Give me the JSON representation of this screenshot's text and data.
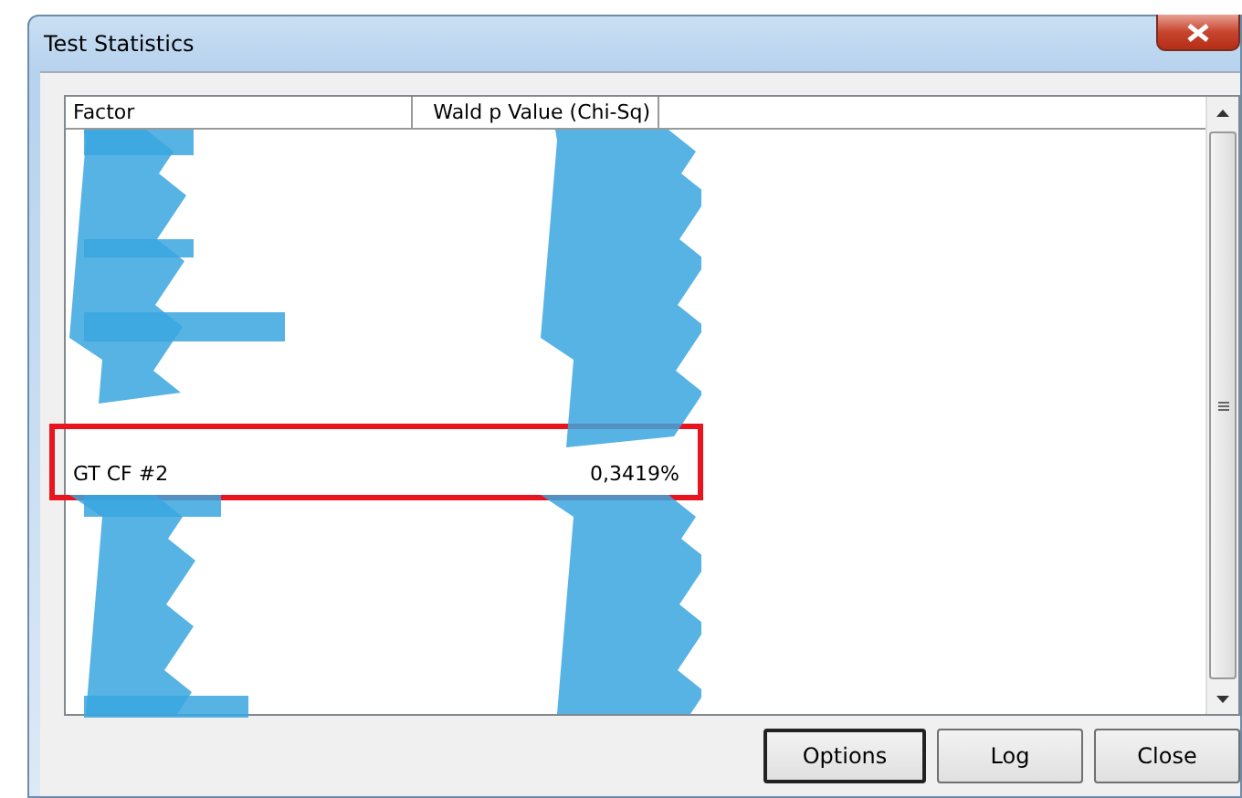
{
  "window": {
    "title": "Test Statistics"
  },
  "table": {
    "columns": [
      "Factor",
      "Wald p Value (Chi-Sq)"
    ],
    "rows": [
      {
        "factor": "GT CF #2",
        "value": "0,3419%",
        "highlighted": true
      }
    ]
  },
  "buttons": [
    {
      "label": "Options",
      "default": true
    },
    {
      "label": "Log",
      "default": false
    },
    {
      "label": "Close",
      "default": false
    }
  ]
}
